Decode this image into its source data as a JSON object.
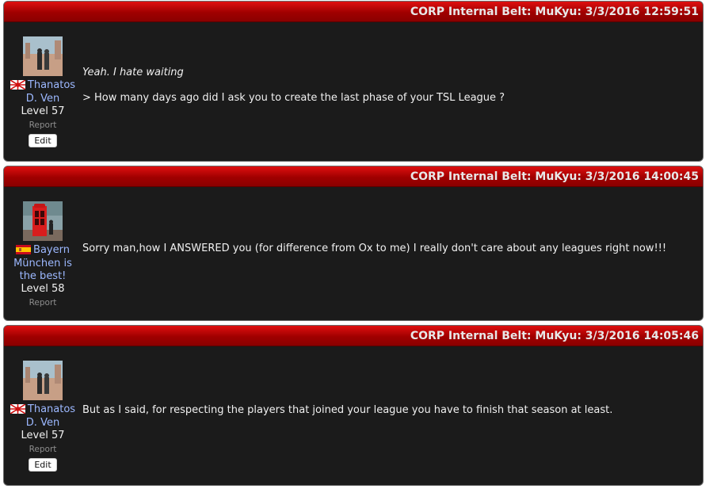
{
  "posts": [
    {
      "header": "CORP Internal Belt: MuKyu: 3/3/2016 12:59:51",
      "author": {
        "name_line1": "Thanatos",
        "name_line2": "D. Ven",
        "level": "Level 57",
        "flag_icon": "rising-sun-flag"
      },
      "report_label": "Report",
      "edit_label": "Edit",
      "message_lines": [
        "Yeah. I hate waiting",
        "> How many days ago did I ask you to create the last phase of your TSL League ?"
      ]
    },
    {
      "header": "CORP Internal Belt: MuKyu: 3/3/2016 14:00:45",
      "author": {
        "name_line1": "Bayern",
        "name_line2": "München is",
        "name_line3": "the best!",
        "level": "Level 58",
        "flag_icon": "spain-flag"
      },
      "report_label": "Report",
      "message_lines": [
        "Sorry man,how I ANSWERED you (for difference from Ox to me) I really don't care about any leagues right now!!!"
      ]
    },
    {
      "header": "CORP Internal Belt: MuKyu: 3/3/2016 14:05:46",
      "author": {
        "name_line1": "Thanatos",
        "name_line2": "D. Ven",
        "level": "Level 57",
        "flag_icon": "rising-sun-flag"
      },
      "report_label": "Report",
      "edit_label": "Edit",
      "message_lines": [
        "But as I said, for respecting the players that joined your league you have to finish that season at least."
      ]
    }
  ]
}
